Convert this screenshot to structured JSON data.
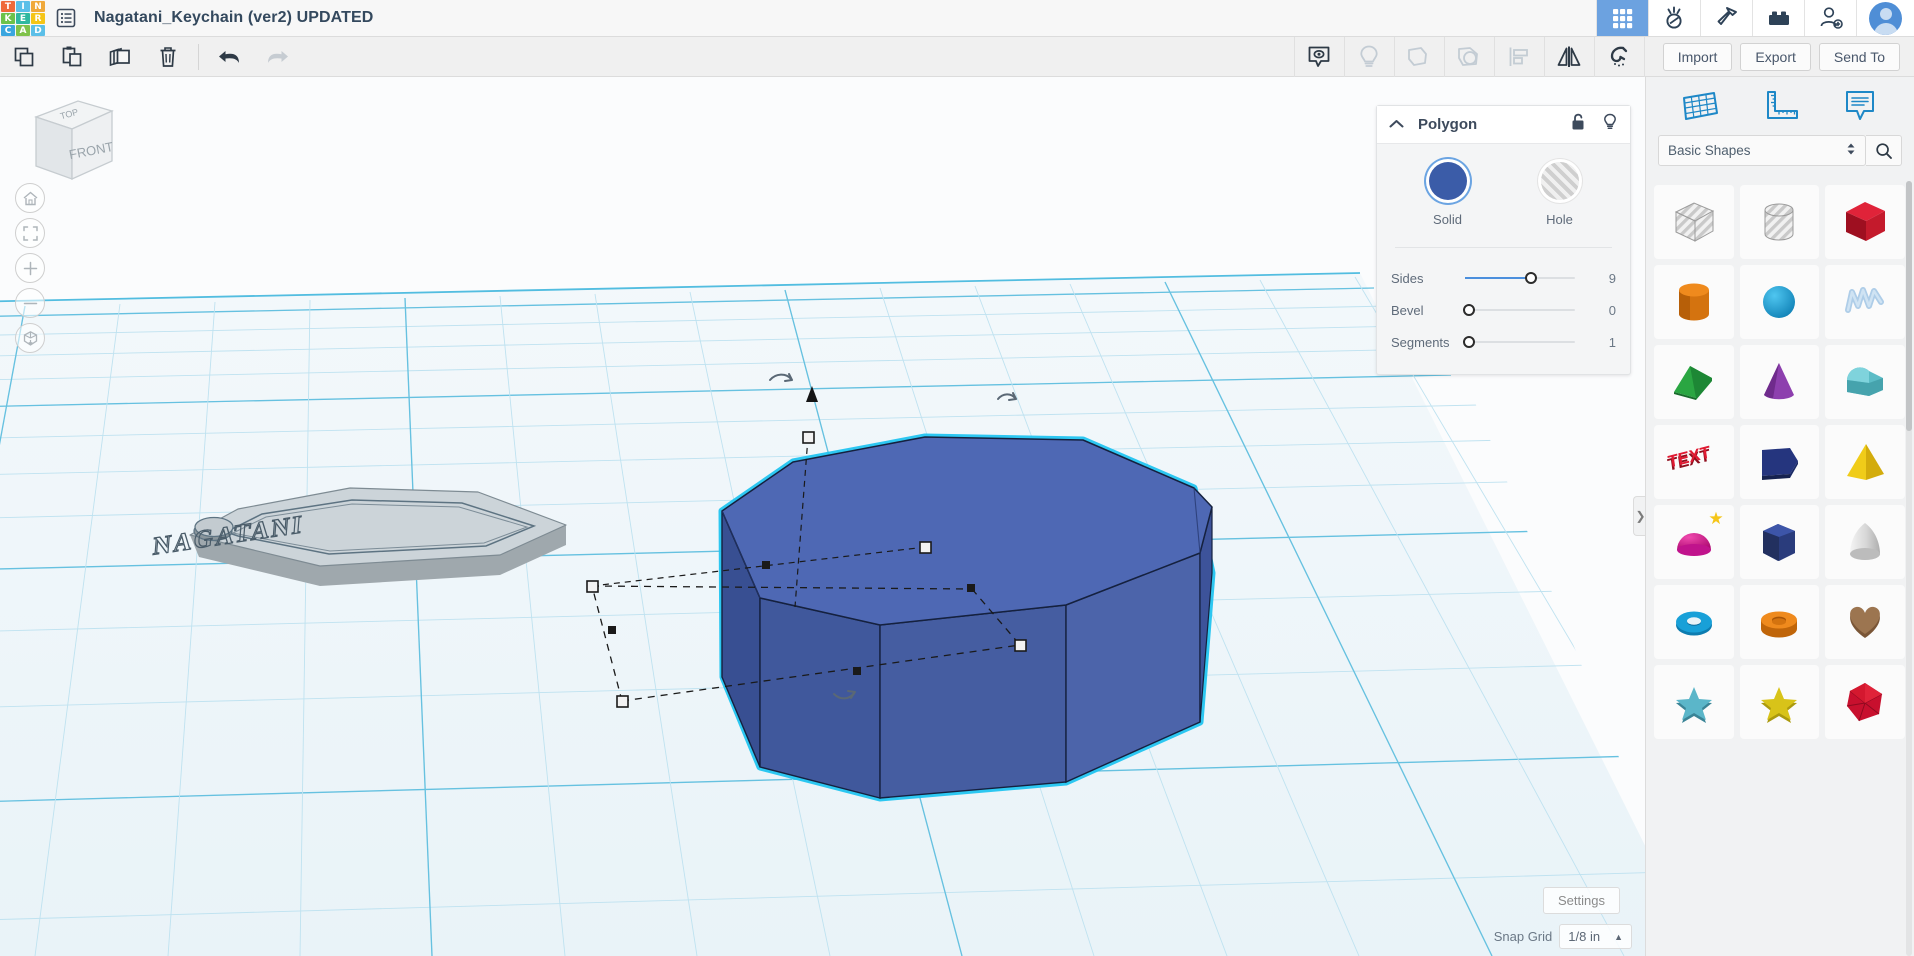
{
  "app": {
    "logo_letters": [
      "T",
      "I",
      "N",
      "K",
      "E",
      "R",
      "C",
      "A",
      "D"
    ],
    "logo_colors": [
      "#ef6a3b",
      "#5bbfe8",
      "#f0a93b",
      "#6cc24a",
      "#2fb8a0",
      "#f5c518",
      "#3aa6df",
      "#7fc24a",
      "#5bbfe8"
    ],
    "menu_icon": "hamburger-list-icon",
    "title": "Nagatani_Keychain (ver2) UPDATED"
  },
  "topbar_right": {
    "items": [
      {
        "name": "designs-grid-icon",
        "label": "3D Designs",
        "active": true
      },
      {
        "name": "circuits-icon",
        "label": "Circuits",
        "active": false
      },
      {
        "name": "codeblocks-hammer-icon",
        "label": "Codeblocks",
        "active": false
      },
      {
        "name": "lego-brick-icon",
        "label": "Lessons",
        "active": false
      },
      {
        "name": "add-person-icon",
        "label": "Invite",
        "active": false
      }
    ],
    "avatar_name": "user-avatar"
  },
  "toolbar": {
    "left_buttons": [
      {
        "name": "copy-button",
        "icon": "copy-icon",
        "label": "Copy",
        "enabled": true
      },
      {
        "name": "paste-button",
        "icon": "paste-icon",
        "label": "Paste",
        "enabled": true
      },
      {
        "name": "duplicate-button",
        "icon": "duplicate-icon",
        "label": "Duplicate",
        "enabled": true
      },
      {
        "name": "delete-button",
        "icon": "trash-icon",
        "label": "Delete",
        "enabled": true
      },
      {
        "name": "undo-button",
        "icon": "undo-arrow-icon",
        "label": "Undo",
        "enabled": true
      },
      {
        "name": "redo-button",
        "icon": "redo-arrow-icon",
        "label": "Redo",
        "enabled": false
      }
    ],
    "right_buttons": [
      {
        "name": "notes-button",
        "icon": "note-bubble-icon",
        "label": "Notes",
        "enabled": true
      },
      {
        "name": "lightbulb-button",
        "icon": "lightbulb-icon",
        "label": "Hint",
        "enabled": false
      },
      {
        "name": "group-button",
        "icon": "group-shapes-icon",
        "label": "Group",
        "enabled": false
      },
      {
        "name": "ungroup-button",
        "icon": "ungroup-shapes-icon",
        "label": "Ungroup",
        "enabled": false
      },
      {
        "name": "align-button",
        "icon": "align-icon",
        "label": "Align",
        "enabled": false
      },
      {
        "name": "mirror-button",
        "icon": "mirror-flip-icon",
        "label": "Mirror",
        "enabled": true
      },
      {
        "name": "snap-magnet-button",
        "icon": "magnet-icon",
        "label": "Snap",
        "enabled": true
      }
    ],
    "actions": [
      {
        "name": "import-button",
        "label": "Import"
      },
      {
        "name": "export-button",
        "label": "Export"
      },
      {
        "name": "send-to-button",
        "label": "Send To"
      }
    ]
  },
  "canvas": {
    "view_cube": {
      "top_face": "TOP",
      "front_face": "FRONT",
      "side_face": ""
    },
    "nav_buttons": [
      {
        "name": "home-view-button",
        "icon": "home-icon"
      },
      {
        "name": "fit-view-button",
        "icon": "fit-to-view-icon"
      },
      {
        "name": "zoom-in-button",
        "icon": "plus-icon"
      },
      {
        "name": "zoom-out-button",
        "icon": "minus-icon"
      },
      {
        "name": "perspective-toggle-button",
        "icon": "ortho-cube-icon"
      }
    ],
    "settings_label": "Settings",
    "snap_grid_label": "Snap Grid",
    "snap_grid_value": "1/8 in",
    "objects": [
      {
        "name": "keychain-object",
        "label": "NAGATANI",
        "selected": false,
        "color": "#cbd3d8"
      },
      {
        "name": "polygon-object",
        "label": "",
        "selected": true,
        "color": "#3f5aa6"
      }
    ],
    "grid_color": "#7ec8e3",
    "selection_outline_color": "#22c4f0"
  },
  "properties": {
    "title": "Polygon",
    "collapse_icon": "chevron-up-icon",
    "lock_icon": "unlock-icon",
    "visibility_icon": "lightbulb-icon",
    "modes": [
      {
        "name": "solid-mode",
        "label": "Solid",
        "selected": true,
        "color": "#3b5ca8"
      },
      {
        "name": "hole-mode",
        "label": "Hole",
        "selected": false,
        "color": "#cfcfcf"
      }
    ],
    "sliders": [
      {
        "name": "sides-slider",
        "label": "Sides",
        "value": "9",
        "fill_pct": 60
      },
      {
        "name": "bevel-slider",
        "label": "Bevel",
        "value": "0",
        "fill_pct": 0
      },
      {
        "name": "segments-slider",
        "label": "Segments",
        "value": "1",
        "fill_pct": 0
      }
    ]
  },
  "shapes_panel": {
    "tools": [
      {
        "name": "workplane-tool",
        "icon": "workplane-grid-icon",
        "label": "Workplane"
      },
      {
        "name": "ruler-tool",
        "icon": "ruler-icon",
        "label": "Ruler"
      },
      {
        "name": "note-tool",
        "icon": "note-bubble-icon",
        "label": "Note"
      }
    ],
    "category": "Basic Shapes",
    "category_icon": "chevron-updown-icon",
    "search_icon": "search-icon",
    "items": [
      {
        "name": "shape-box-hole",
        "label": "Box Hole",
        "kind": "box",
        "color": "hole",
        "starred": false
      },
      {
        "name": "shape-cylinder-hole",
        "label": "Cylinder Hole",
        "kind": "cylinder",
        "color": "hole",
        "starred": false
      },
      {
        "name": "shape-box",
        "label": "Box",
        "kind": "box",
        "color": "#c8102e",
        "starred": false
      },
      {
        "name": "shape-cylinder",
        "label": "Cylinder",
        "kind": "cylinder",
        "color": "#e8801a",
        "starred": false
      },
      {
        "name": "shape-sphere",
        "label": "Sphere",
        "kind": "sphere",
        "color": "#169bd5",
        "starred": false
      },
      {
        "name": "shape-scribble",
        "label": "Scribble",
        "kind": "scribble",
        "color": "#aecde8",
        "starred": false
      },
      {
        "name": "shape-wedge",
        "label": "Wedge",
        "kind": "wedge",
        "color": "#2aa642",
        "starred": false
      },
      {
        "name": "shape-cone",
        "label": "Cone",
        "kind": "cone",
        "color": "#8d3fae",
        "starred": false
      },
      {
        "name": "shape-roof",
        "label": "Roof",
        "kind": "roof",
        "color": "#5cbcc6",
        "starred": false
      },
      {
        "name": "shape-text",
        "label": "Text",
        "kind": "text",
        "color": "#d41a32",
        "starred": false
      },
      {
        "name": "shape-extrusion",
        "label": "Extrusion",
        "kind": "extrusion",
        "color": "#25357e",
        "starred": false
      },
      {
        "name": "shape-pyramid",
        "label": "Pyramid",
        "kind": "pyramid",
        "color": "#f0cc19",
        "starred": false
      },
      {
        "name": "shape-half-sphere",
        "label": "Half Sphere",
        "kind": "halfsphere",
        "color": "#d6148c",
        "starred": true
      },
      {
        "name": "shape-polygon",
        "label": "Polygon",
        "kind": "polygon",
        "color": "#2f4388",
        "starred": false
      },
      {
        "name": "shape-paraboloid",
        "label": "Paraboloid",
        "kind": "paraboloid",
        "color": "#d8d8d8",
        "starred": false
      },
      {
        "name": "shape-torus",
        "label": "Torus",
        "kind": "torus",
        "color": "#18a0d8",
        "starred": false
      },
      {
        "name": "shape-tube",
        "label": "Tube",
        "kind": "tube",
        "color": "#e8801a",
        "starred": false
      },
      {
        "name": "shape-heart",
        "label": "Heart",
        "kind": "heart",
        "color": "#9c7550",
        "starred": false
      },
      {
        "name": "shape-star-teal",
        "label": "Star",
        "kind": "star",
        "color": "#4d9fb5",
        "starred": false
      },
      {
        "name": "shape-star-yellow",
        "label": "Star",
        "kind": "star",
        "color": "#d8c319",
        "starred": false
      },
      {
        "name": "shape-polyhedron",
        "label": "Polyhedron",
        "kind": "polyhedron",
        "color": "#c8102e",
        "starred": false
      }
    ]
  },
  "panel_collapse_icon": "chevron-right-icon"
}
